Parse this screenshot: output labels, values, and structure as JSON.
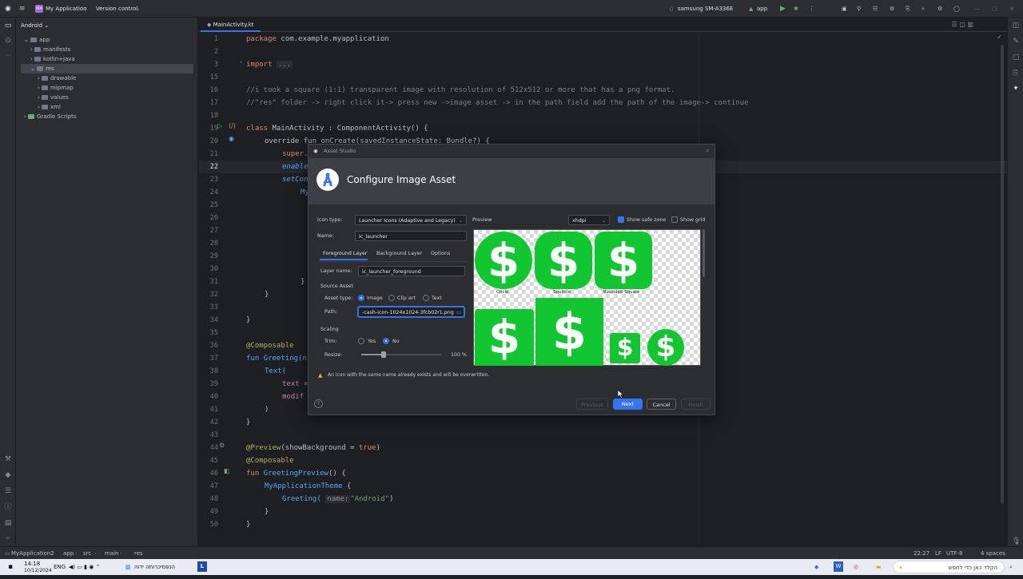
{
  "titlebar": {
    "project_badge": "MA",
    "project_name": "My Application",
    "vcs": "Version control",
    "device": "samsung SM-A336E",
    "run_config": "app"
  },
  "project_panel": {
    "view": "Android",
    "tree": [
      {
        "label": "app"
      },
      {
        "label": "manifests"
      },
      {
        "label": "kotlin+java"
      },
      {
        "label": "res"
      },
      {
        "label": "drawable"
      },
      {
        "label": "mipmap"
      },
      {
        "label": "values"
      },
      {
        "label": "xml"
      },
      {
        "label": "Gradle Scripts"
      }
    ]
  },
  "editor": {
    "tab": "MainActivity.kt",
    "line_numbers": [
      "1",
      "2",
      "3",
      "15",
      "16",
      "17",
      "18",
      "19",
      "20",
      "21",
      "22",
      "23",
      "24",
      "25",
      "26",
      "27",
      "28",
      "29",
      "30",
      "31",
      "32",
      "33",
      "34",
      "35",
      "36",
      "37",
      "38",
      "39",
      "40",
      "41",
      "42",
      "43",
      "44",
      "45",
      "46",
      "47",
      "48",
      "49",
      "50"
    ],
    "lines": {
      "l1_kw": "package",
      "l1_rest": " com.example.myapplication",
      "l3_kw": "import",
      "l3_rest": "...",
      "l15": "//i took a square (1:1) transparent image with resolution of 512x512 or more that has a png format.",
      "l16": "//\"res\" folder -> right click it-> press new ->image asset -> in the path field add the path of the image-> continue",
      "l18_kw": "class",
      "l18_rest": " MainActivity : ComponentActivity() {",
      "l19": "override fun onCreate(savedInstanceState: Bundle?) {",
      "l20": "super.",
      "l21": "enable",
      "l22": "setCon",
      "l23": "My",
      "l29": "}",
      "l30": "}",
      "l31": "}",
      "l33": "@Composable",
      "l34": "fun Greeting(n",
      "l35": "Text(",
      "l36": "text =",
      "l37": "modif",
      "l38": ")",
      "l39": "}",
      "l41_an": "@Preview",
      "l41_rest": "(showBackground = ",
      "l41_kw": "true",
      "l41_end": ")",
      "l42": "@Composable",
      "l43_kw": "fun",
      "l43_fn": " GreetingPreview",
      "l43_rest": "() {",
      "l44_fn": "MyApplicationTheme",
      "l44_rest": " {",
      "l45_fn": "Greeting(",
      "l45_hint": "name:",
      "l45_str": "\"Android\"",
      "l45_end": ")",
      "l46": "}",
      "l47": "}"
    }
  },
  "dialog": {
    "window_title": "Asset Studio",
    "heading": "Configure Image Asset",
    "icon_type_label": "Icon type:",
    "icon_type_value": "Launcher Icons (Adaptive and Legacy)",
    "name_label": "Name:",
    "name_value": "ic_launcher",
    "tabs": [
      "Foreground Layer",
      "Background Layer",
      "Options"
    ],
    "layer_name_label": "Layer name:",
    "layer_name_value": "ic_launcher_foreground",
    "source_asset": "Source Asset",
    "asset_type_label": "Asset type:",
    "asset_types": [
      "Image",
      "Clip art",
      "Text"
    ],
    "path_label": "Path:",
    "path_value": "-cash-icon-1024x1024-3fcb02r1.png",
    "scaling": "Scaling",
    "trim_label": "Trim:",
    "trim_yes": "Yes",
    "trim_no": "No",
    "resize_label": "Resize:",
    "resize_value": "100 %",
    "resize_level": 0.28,
    "preview_label": "Preview",
    "density": "xhdpi",
    "show_safe_zone": "Show safe zone",
    "show_grid": "Show grid",
    "preview_captions": [
      "Circle",
      "Squircle",
      "Rounded Square"
    ],
    "icon_glyph": "$",
    "warning": "An icon with the same name already exists and will be overwritten.",
    "help": "?",
    "buttons": {
      "previous": "Previous",
      "next": "Next",
      "cancel": "Cancel",
      "finish": "Finish"
    }
  },
  "statusbar": {
    "crumbs": [
      "MyApplication2",
      "app",
      "src",
      "main",
      "res"
    ],
    "position": "22:27",
    "line_sep": "LF",
    "encoding": "UTF-8",
    "indent": "4 spaces"
  },
  "taskbar": {
    "time": "14:18",
    "date": "10/12/2024",
    "lang": "ENG",
    "app_item": "הנפמיכרותה ידוה",
    "search": "הקלד כאן כדי לחפש"
  },
  "colors": {
    "accent": "#3574f0",
    "green": "#12c632"
  }
}
